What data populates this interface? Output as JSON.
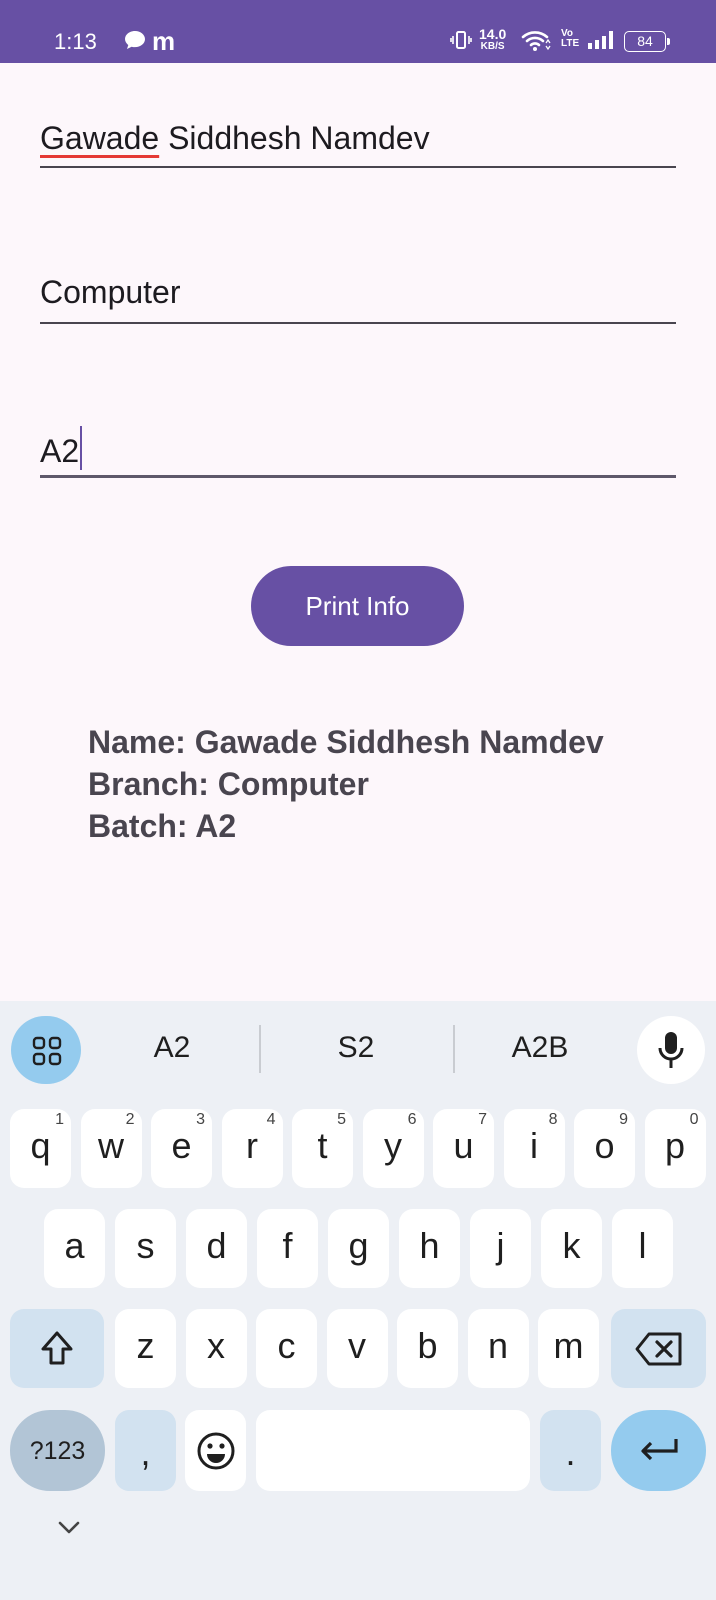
{
  "status_bar": {
    "time": "1:13",
    "app_icon": "m",
    "net_speed_value": "14.0",
    "net_speed_unit": "KB/S",
    "volte_top": "Vo",
    "volte_bottom": "LTE",
    "battery": "84"
  },
  "form": {
    "name_first": "Gawade",
    "name_rest": " Siddhesh Namdev",
    "branch": "Computer",
    "batch": "A2",
    "button_label": "Print Info"
  },
  "result": {
    "name_line": "Name: Gawade Siddhesh Namdev",
    "branch_line": "Branch: Computer",
    "batch_line": "Batch: A2"
  },
  "keyboard": {
    "suggestions": [
      "A2",
      "S2",
      "A2B"
    ],
    "row1": [
      {
        "ch": "q",
        "num": "1"
      },
      {
        "ch": "w",
        "num": "2"
      },
      {
        "ch": "e",
        "num": "3"
      },
      {
        "ch": "r",
        "num": "4"
      },
      {
        "ch": "t",
        "num": "5"
      },
      {
        "ch": "y",
        "num": "6"
      },
      {
        "ch": "u",
        "num": "7"
      },
      {
        "ch": "i",
        "num": "8"
      },
      {
        "ch": "o",
        "num": "9"
      },
      {
        "ch": "p",
        "num": "0"
      }
    ],
    "row2": [
      "a",
      "s",
      "d",
      "f",
      "g",
      "h",
      "j",
      "k",
      "l"
    ],
    "row3": [
      "z",
      "x",
      "c",
      "v",
      "b",
      "n",
      "m"
    ],
    "symbols_label": "?123",
    "comma": ",",
    "period": ".",
    "colors": {
      "accent": "#6750a4",
      "enter": "#94cbee",
      "modifier": "#d2e2f0"
    }
  }
}
